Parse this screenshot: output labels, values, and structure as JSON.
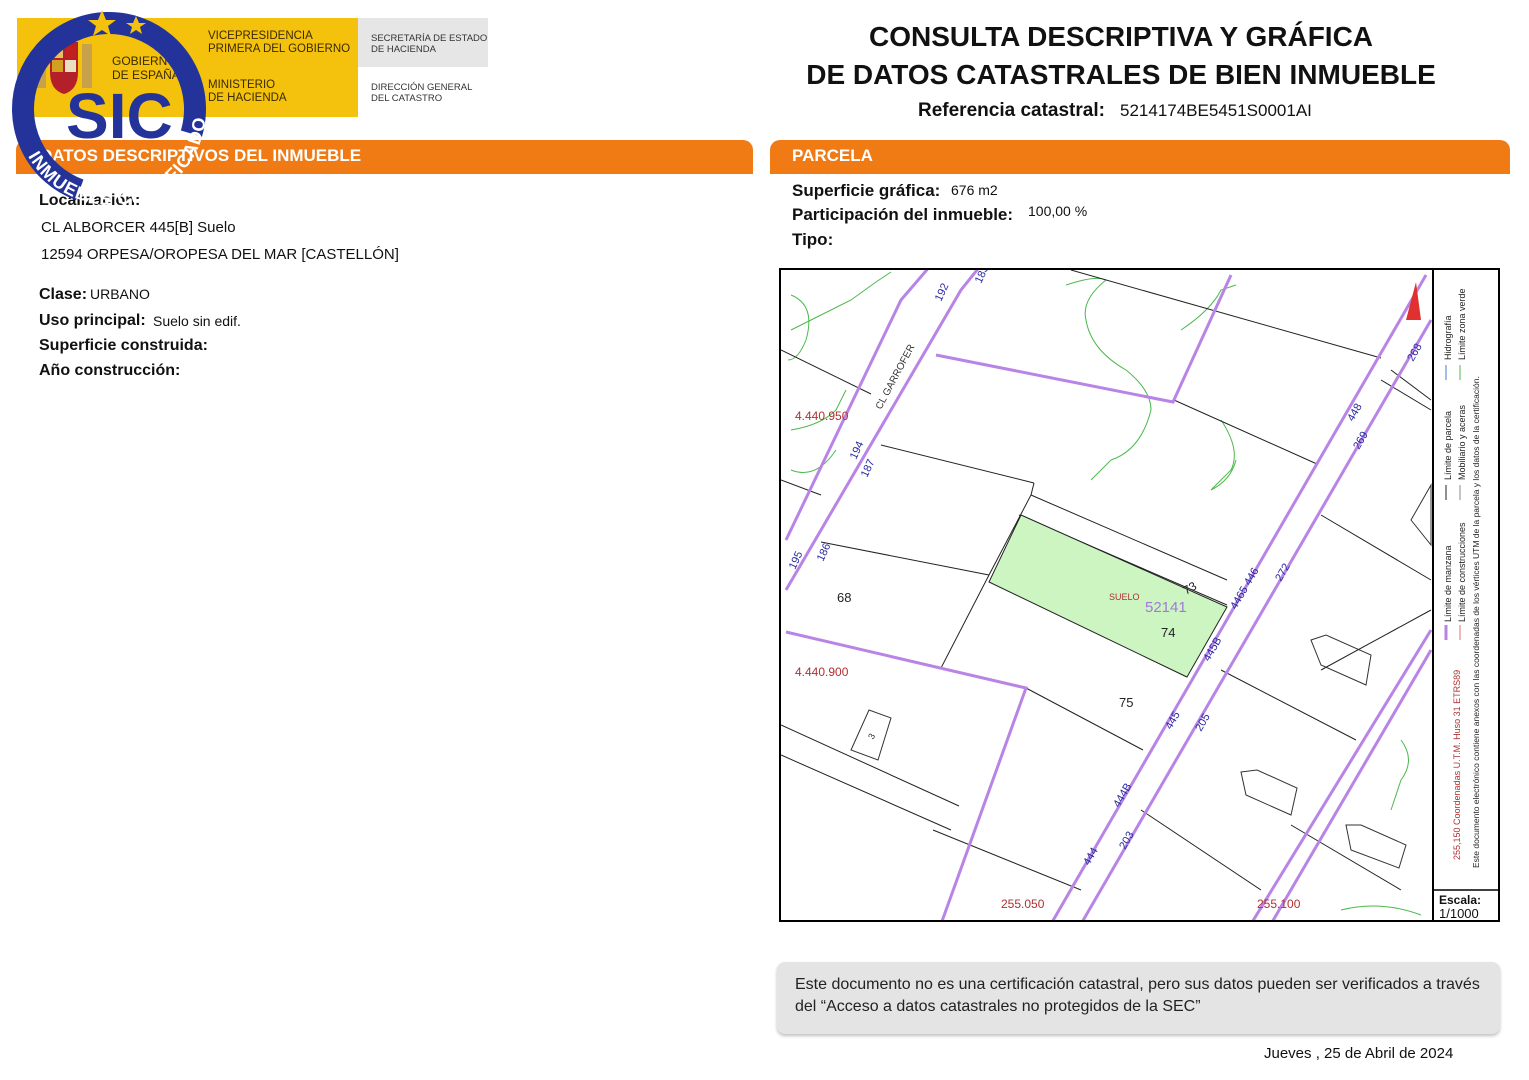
{
  "header": {
    "gov_name_line1": "GOBIERNO",
    "gov_name_line2": "DE ESPAÑA",
    "vice_line1": "VICEPRESIDENCIA",
    "vice_line2": "PRIMERA DEL GOBIERNO",
    "min_line1": "MINISTERIO",
    "min_line2": "DE HACIENDA",
    "sec_line1": "SECRETARÍA DE ESTADO",
    "sec_line2": "DE HACIENDA",
    "dg_line1": "DIRECCIÓN GENERAL",
    "dg_line2": "DEL CATASTRO"
  },
  "title": {
    "line1": "CONSULTA DESCRIPTIVA Y GRÁFICA",
    "line2": "DE DATOS CATASTRALES DE BIEN INMUEBLE",
    "ref_label": "Referencia catastral:",
    "ref_value": "5214174BE5451S0001AI"
  },
  "stamp": {
    "text_sic": "SIC",
    "text_arc": "INMUEBLE CERTIFICADO"
  },
  "inmueble": {
    "section_title": "DATOS DESCRIPTIVOS DEL INMUEBLE",
    "localizacion_label": "Localización:",
    "address_line1": "CL ALBORCER 445[B] Suelo",
    "address_line2": "12594 ORPESA/OROPESA DEL MAR [CASTELLÓN]",
    "clase_label": "Clase:",
    "clase_value": "URBANO",
    "uso_label": "Uso principal:",
    "uso_value": "Suelo sin edif.",
    "superficie_label": "Superficie construida:",
    "anio_label": "Año construcción:"
  },
  "parcela": {
    "section_title": "PARCELA",
    "superficie_label": "Superficie gráfica:",
    "superficie_value": "676 m2",
    "participacion_label": "Participación del inmueble:",
    "participacion_value": "100,00 %",
    "tipo_label": "Tipo:"
  },
  "map": {
    "coord_y1": "4.440.950",
    "coord_y2": "4.440.900",
    "coord_x1": "255.050",
    "coord_x2": "255.100",
    "street": "CL GARROFER",
    "suelo": "SUELO",
    "parcel_ref": "52141",
    "lot_68": "68",
    "lot_73": "73",
    "lot_74": "74",
    "lot_75": "75",
    "n_192": "192",
    "n_194": "194",
    "n_187": "187",
    "n_186": "186",
    "n_195": "195",
    "n_183": "183",
    "n_268": "268",
    "n_448": "448",
    "n_269": "269",
    "n_272": "272",
    "n_446": "4465 446",
    "n_445b": "445B",
    "n_445": "445",
    "n_205": "205",
    "n_444b": "444B",
    "n_444": "444",
    "n_203": "203",
    "n_3": "3",
    "legend": {
      "manzana": "Límite de manzana",
      "parcela": "Límite de parcela",
      "hidrografia": "Hidrografía",
      "construcciones": "Límite de construcciones",
      "mobiliario": "Mobiliario y aceras",
      "zona_verde": "Límite zona verde",
      "coords": "255,150 Coordenadas U.T.M. Huso 31 ETRS89",
      "doc_note": "Este documento electrónico contiene anexos con las coordenadas de los vértices UTM de la parcela y los datos de la certificación."
    },
    "escala_label": "Escala:",
    "escala_value": "1/1000"
  },
  "note": "Este documento no es una certificación catastral, pero sus datos pueden ser verificados a través del “Acceso a datos catastrales no protegidos de la SEC”",
  "date": "Jueves , 25 de Abril de 2024",
  "colors": {
    "orange": "#f07b14",
    "gold": "#f4c20d",
    "stamp_blue": "#23339a",
    "parcel_line": "#b884e6",
    "green_fill": "#cdf5c2"
  }
}
